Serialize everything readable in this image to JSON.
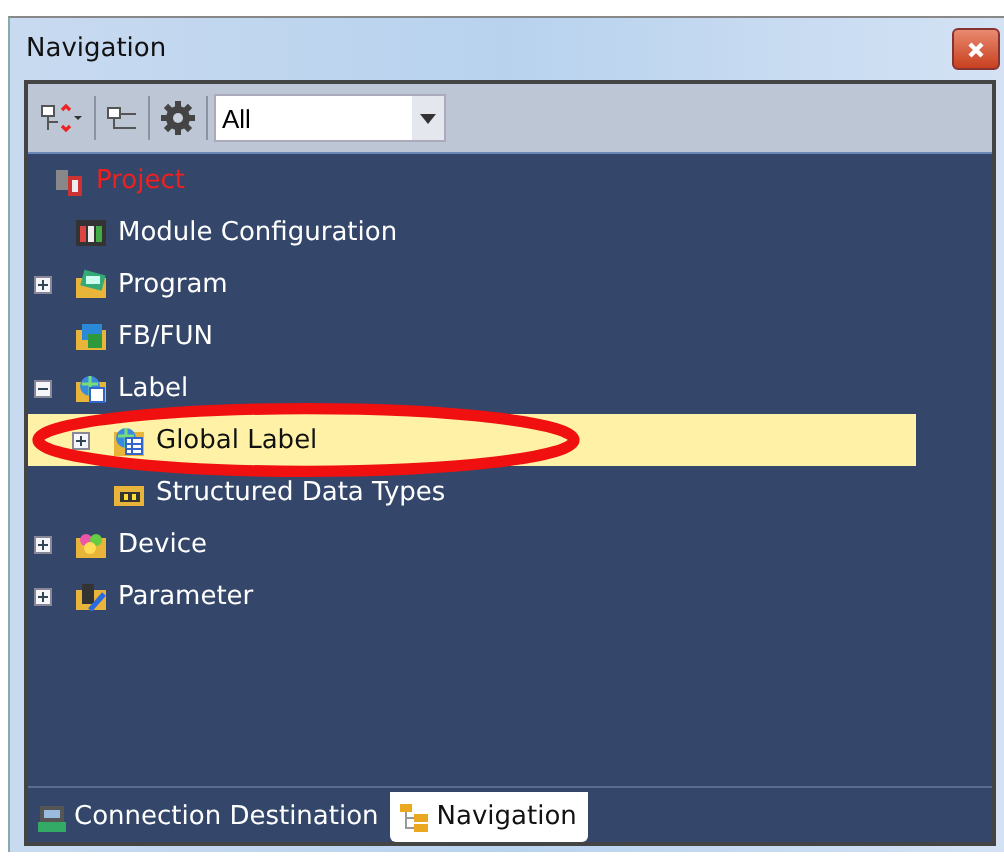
{
  "window": {
    "title": "Navigation"
  },
  "toolbar": {
    "filter": {
      "value": "All"
    }
  },
  "tree": [
    {
      "label": "Project",
      "selected": false,
      "children": [
        {
          "label": "Module Configuration",
          "kind": "leaf",
          "selected": false
        },
        {
          "label": "Program",
          "kind": "collapsed",
          "selected": false
        },
        {
          "label": "FB/FUN",
          "kind": "leaf",
          "selected": false
        },
        {
          "label": "Label",
          "kind": "expanded",
          "selected": false,
          "children": [
            {
              "label": "Global Label",
              "kind": "collapsed",
              "selected": true,
              "circled": true
            },
            {
              "label": "Structured Data Types",
              "kind": "leaf",
              "selected": false
            }
          ]
        },
        {
          "label": "Device",
          "kind": "collapsed",
          "selected": false
        },
        {
          "label": "Parameter",
          "kind": "collapsed",
          "selected": false
        }
      ]
    }
  ],
  "tabs": [
    {
      "label": "Connection Destination",
      "selected": false
    },
    {
      "label": "Navigation",
      "selected": true
    }
  ]
}
